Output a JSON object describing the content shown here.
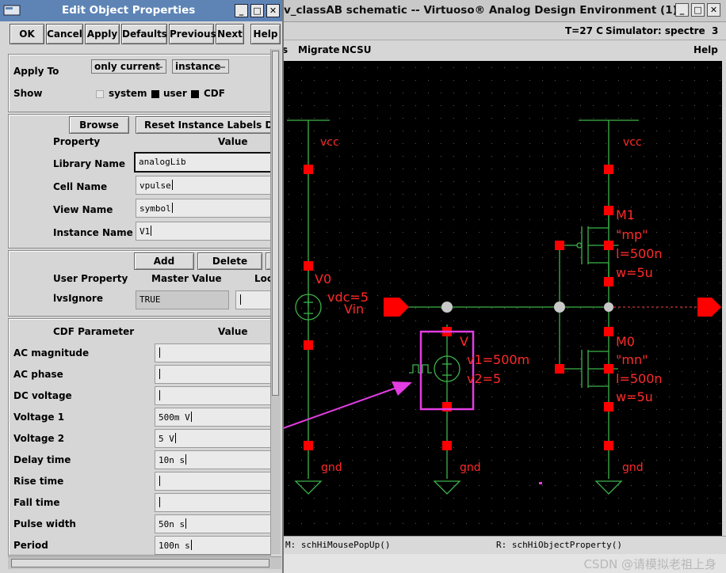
{
  "main_window": {
    "title": "v_classAB schematic -- Virtuoso® Analog Design Environment (1)",
    "status_temp": "T=27 C",
    "status_simulator": "Simulator: spectre",
    "status_num": "3",
    "menu_items": [
      "s",
      "Migrate",
      "NCSU"
    ],
    "menu_help": "Help",
    "mouse_left": "M: schHiMousePopUp()",
    "mouse_right": "R: schHiObjectProperty()",
    "watermark": "CSDN @请模拟老祖上身"
  },
  "schematic": {
    "labels": {
      "vcc_left": "vcc",
      "vcc_right": "vcc",
      "v0_name": "V0",
      "v0_param": "vdc=5",
      "vin": "Vin",
      "v1_name": "V",
      "v1_param1": "v1=500m",
      "v1_param2": "v2=5",
      "m1_name": "M1",
      "m1_model": "\"mp\"",
      "m1_l": "l=500n",
      "m1_w": "w=5u",
      "m0_name": "M0",
      "m0_model": "\"mn\"",
      "m0_l": "l=500n",
      "m0_w": "w=5u",
      "gnd_left": "gnd",
      "gnd_mid": "gnd",
      "gnd_right": "gnd"
    }
  },
  "dialog": {
    "title": "Edit Object Properties",
    "buttons": [
      "OK",
      "Cancel",
      "Apply",
      "Defaults",
      "Previous",
      "Next",
      "Help"
    ],
    "apply_to_label": "Apply To",
    "apply_to_scope": "only current",
    "apply_to_kind": "instance",
    "show_label": "Show",
    "show_system": "system",
    "show_user": "user",
    "show_cdf": "CDF",
    "browse": "Browse",
    "reset_labels": "Reset Instance Labels Display",
    "property_header": "Property",
    "value_header": "Value",
    "props": [
      {
        "label": "Library Name",
        "value": "analogLib"
      },
      {
        "label": "Cell Name",
        "value": "vpulse"
      },
      {
        "label": "View Name",
        "value": "symbol"
      },
      {
        "label": "Instance Name",
        "value": "V1"
      }
    ],
    "add": "Add",
    "delete": "Delete",
    "user_property_header": "User Property",
    "master_value_header": "Master Value",
    "local_header": "Local Value",
    "lvs_label": "lvsIgnore",
    "lvs_value": "TRUE",
    "cdf_param_header": "CDF Parameter",
    "cdf_value_header": "Value",
    "cdf": [
      {
        "label": "AC magnitude",
        "value": ""
      },
      {
        "label": "AC phase",
        "value": ""
      },
      {
        "label": "DC voltage",
        "value": ""
      },
      {
        "label": "Voltage 1",
        "value": "500m V"
      },
      {
        "label": "Voltage 2",
        "value": "5 V"
      },
      {
        "label": "Delay time",
        "value": "10n s"
      },
      {
        "label": "Rise time",
        "value": ""
      },
      {
        "label": "Fall time",
        "value": ""
      },
      {
        "label": "Pulse width",
        "value": "50n s"
      },
      {
        "label": "Period",
        "value": "100n s"
      }
    ]
  },
  "colors": {
    "wire": "#3cb44a",
    "pin": "#ff0000",
    "label": "#ff2a2a",
    "selection": "#e23de2",
    "dialog_title": "#5e84b6",
    "junction": "#c8c8c8"
  }
}
